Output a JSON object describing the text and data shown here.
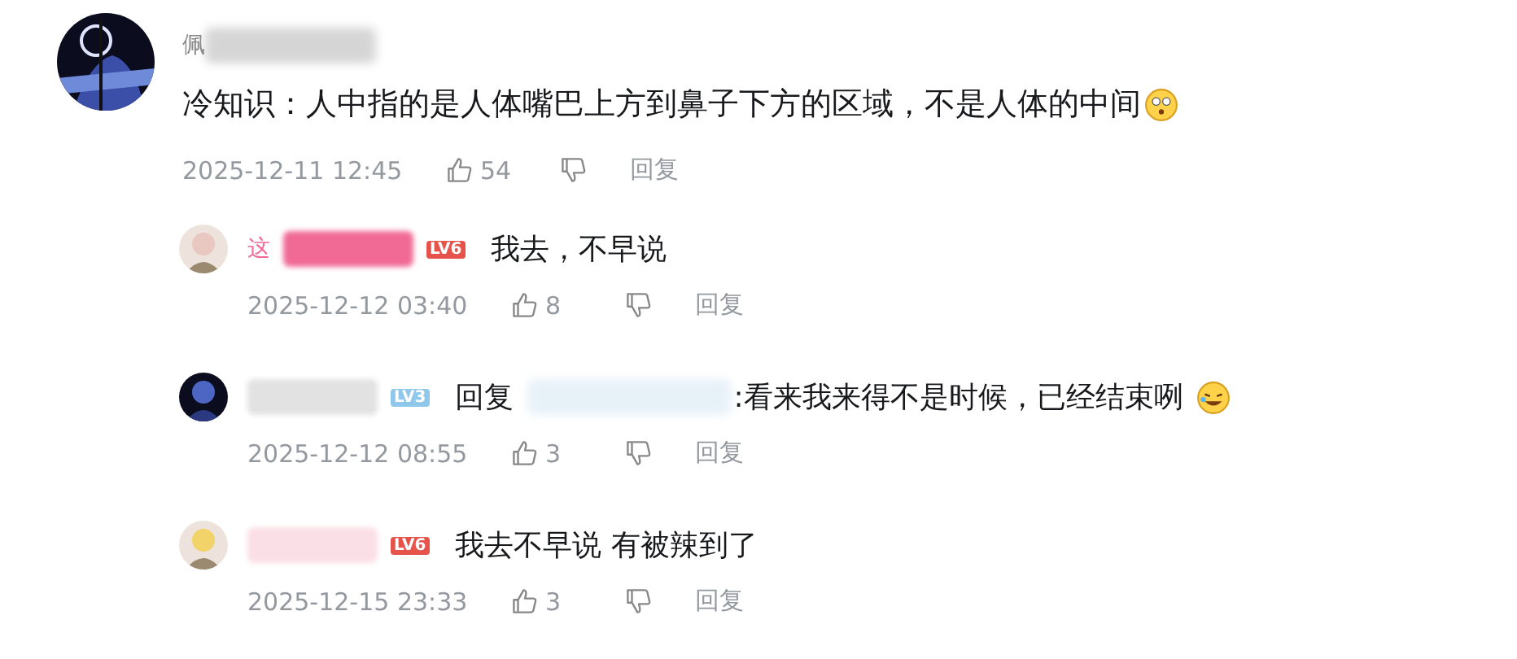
{
  "comment": {
    "user": {
      "name": "佩",
      "color": "#8a8a8a"
    },
    "text": "冷知识：人中指的是人体嘴巴上方到鼻子下方的区域，不是人体的中间",
    "emoji": true,
    "time": "2025-12-11 12:45",
    "likes": "54",
    "reply_label": "回复"
  },
  "replies": [
    {
      "kind": "plain",
      "user": {
        "name": "这",
        "color": "#f06a95"
      },
      "badge": {
        "text": "LV6",
        "color": "#e5534b"
      },
      "text": "我去，不早说",
      "emoji": false,
      "time": "2025-12-12 03:40",
      "likes": "8",
      "reply_label": "回复"
    },
    {
      "kind": "reply_to",
      "user": {
        "color": "#e2e2e2"
      },
      "badge": {
        "text": "LV3",
        "color": "#8fc8ea"
      },
      "reply_word": "回复",
      "text": ":看来我来得不是时候，已经结束咧",
      "emoji": true,
      "time": "2025-12-12 08:55",
      "likes": "3",
      "reply_label": "回复"
    },
    {
      "kind": "plain",
      "user": {
        "color": "#fbdfe6"
      },
      "badge": {
        "text": "LV6",
        "color": "#e5534b"
      },
      "text": "我去不早说 有被辣到了",
      "emoji": false,
      "time": "2025-12-15 23:33",
      "likes": "3",
      "reply_label": "回复"
    }
  ]
}
